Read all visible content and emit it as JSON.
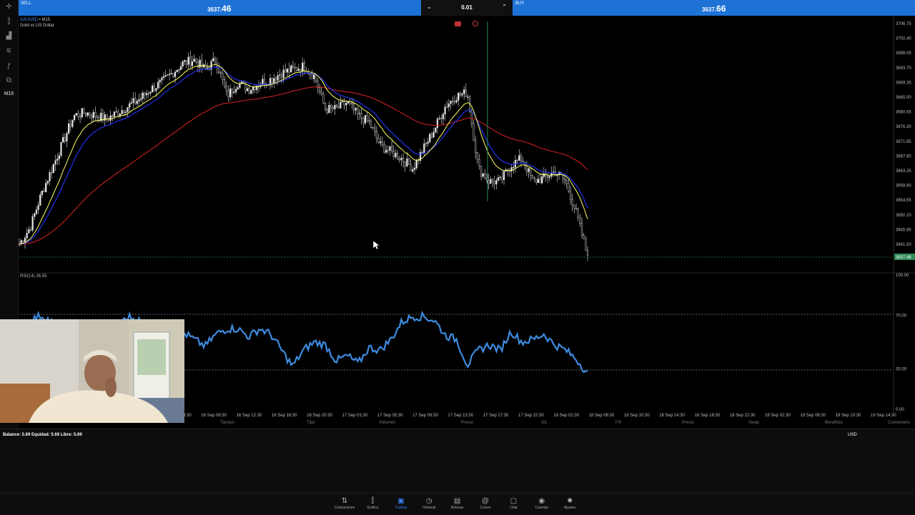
{
  "trade_bar": {
    "sell_label": "SELL",
    "sell_price_main": "3637.",
    "sell_price_frac": "46",
    "lot": "0.01",
    "buy_label": "BUY",
    "buy_price_main": "3637.",
    "buy_price_frac": "66"
  },
  "symbol": {
    "name": "XAUUSD",
    "timeframe": "M15",
    "description": "Gold vs US Dollar"
  },
  "sidebar": {
    "timeframe_label": "M15"
  },
  "price_axis": {
    "labels": [
      "3706.75",
      "3702.40",
      "3698.05",
      "3693.70",
      "3689.35",
      "3685.00",
      "3680.65",
      "3676.30",
      "3671.95",
      "3667.60",
      "3663.25",
      "3658.90",
      "3654.55",
      "3650.20",
      "3645.85",
      "3641.50"
    ],
    "current_price": "3637.46"
  },
  "rsi": {
    "label": "RSI(14) 26.55",
    "levels": [
      "100.00",
      "70.00",
      "30.00",
      "0.00"
    ]
  },
  "time_axis": [
    "16 Sep 04:30",
    "16 Sep 08:30",
    "16 Sep 12:30",
    "16 Sep 16:30",
    "16 Sep 20:30",
    "17 Sep 01:30",
    "17 Sep 05:30",
    "17 Sep 09:30",
    "17 Sep 13:30",
    "17 Sep 17:30",
    "17 Sep 22:30",
    "18 Sep 02:30",
    "18 Sep 06:30",
    "18 Sep 10:30",
    "18 Sep 14:30",
    "18 Sep 18:30",
    "18 Sep 22:30",
    "19 Sep 02:30",
    "19 Sep 06:30",
    "19 Sep 10:30",
    "19 Sep 14:30"
  ],
  "positions_table": {
    "columns": [
      "Tiempo",
      "Tipo",
      "Volumen",
      "Precio",
      "S/L",
      "T/P",
      "Precio",
      "Swap",
      "Beneficio",
      "Comentario"
    ]
  },
  "account": {
    "balance_text": "Balance: 5.69 Equidad: 5.69 Libre: 5.69",
    "currency": "USD"
  },
  "nav": [
    {
      "label": "Cotizaciones",
      "icon": "quotes-icon"
    },
    {
      "label": "Gráfico",
      "icon": "chart-icon"
    },
    {
      "label": "Trading",
      "icon": "trading-icon",
      "active": true
    },
    {
      "label": "Historial",
      "icon": "history-icon"
    },
    {
      "label": "Noticias",
      "icon": "news-icon"
    },
    {
      "label": "Correo",
      "icon": "mail-icon"
    },
    {
      "label": "Chat",
      "icon": "chat-icon"
    },
    {
      "label": "Cuentas",
      "icon": "accounts-icon"
    },
    {
      "label": "Ajustes",
      "icon": "settings-icon"
    }
  ],
  "colors": {
    "accent": "#1e72d6",
    "candle": "#e8e8e8",
    "ma_fast": "#ffff66",
    "ma_mid": "#2233ee",
    "ma_slow": "#dd2222",
    "rsi_line": "#3d8be0",
    "price_line": "#2e8b57"
  },
  "chart_data": {
    "type": "line",
    "symbol": "XAUUSD",
    "timeframe": "M15",
    "ylim": [
      3637.0,
      3708.0
    ],
    "close_approx": [
      3641,
      3646,
      3656,
      3664,
      3672,
      3680,
      3681,
      3680,
      3679,
      3681,
      3683,
      3685,
      3688,
      3690,
      3693,
      3696,
      3697,
      3694,
      3697,
      3686,
      3690,
      3688,
      3690,
      3691,
      3693,
      3694,
      3695,
      3692,
      3682,
      3682,
      3684,
      3680,
      3678,
      3671,
      3669,
      3667,
      3664,
      3670,
      3676,
      3683,
      3686,
      3687,
      3664,
      3660,
      3660,
      3665,
      3667,
      3660,
      3661,
      3663,
      3660,
      3650,
      3637
    ],
    "rsi_approx": [
      55,
      66,
      70,
      65,
      58,
      63,
      60,
      50,
      55,
      62,
      69,
      66,
      55,
      60,
      50,
      57,
      52,
      47,
      56,
      60,
      60,
      54,
      60,
      56,
      44,
      32,
      44,
      50,
      48,
      36,
      40,
      34,
      46,
      44,
      52,
      65,
      69,
      69,
      66,
      55,
      52,
      33,
      44,
      48,
      44,
      58,
      50,
      52,
      56,
      48,
      44,
      37,
      27
    ],
    "current_price": 3637.46,
    "rsi_value": 26.55
  }
}
